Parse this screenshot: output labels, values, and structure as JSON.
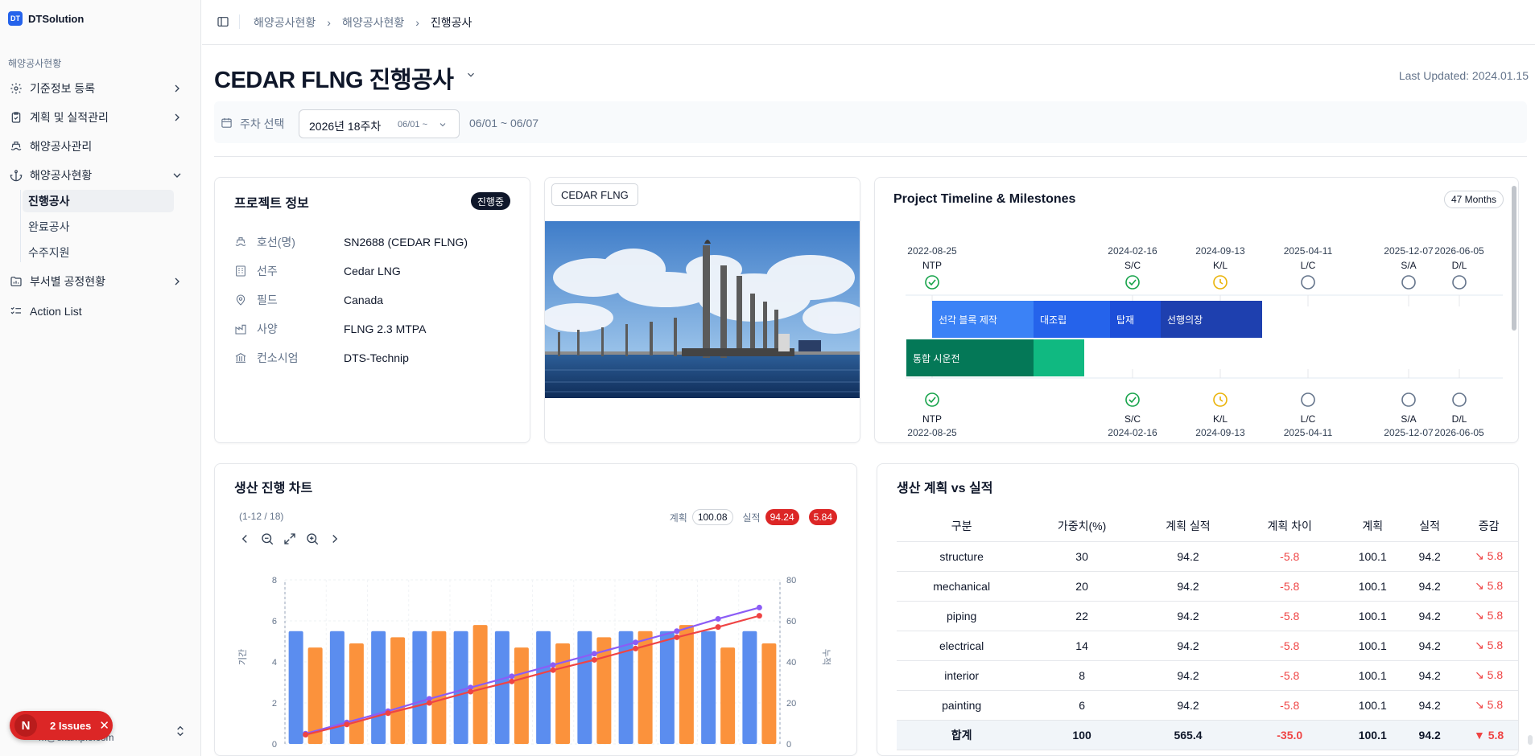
{
  "sidebar": {
    "brand": {
      "logo": "DT",
      "name": "DTSolution"
    },
    "group_label": "해양공사현황",
    "items": [
      {
        "label": "기준정보 등록",
        "icon": "gear-icon"
      },
      {
        "label": "계획 및 실적관리",
        "icon": "clipboard-icon"
      },
      {
        "label": "해양공사관리",
        "icon": "ship-icon"
      },
      {
        "label": "해양공사현황",
        "icon": "anchor-icon"
      },
      {
        "label": "부서별 공정현황",
        "icon": "folder-chart-icon"
      },
      {
        "label": "Action List",
        "icon": "list-check-icon"
      }
    ],
    "subitems": [
      "진행공사",
      "완료공사",
      "수주지원"
    ],
    "footer_email": "m@example.com"
  },
  "issues_badge": {
    "initial": "N",
    "label": "2 Issues"
  },
  "breadcrumb": [
    "해양공사현황",
    "해양공사현황",
    "진행공사"
  ],
  "page": {
    "title": "CEDAR FLNG 진행공사",
    "last_updated": "Last Updated: 2024.01.15"
  },
  "week_filter": {
    "label": "주차 선택",
    "selected": "2026년 18주차",
    "selected_sub": "06/01 ~",
    "range": "06/01 ~ 06/07"
  },
  "project_info": {
    "title": "프로젝트 정보",
    "status": "진행중",
    "rows": [
      {
        "label": "호선(명)",
        "value": "SN2688 (CEDAR FLNG)",
        "icon": "ship-icon"
      },
      {
        "label": "선주",
        "value": "Cedar LNG",
        "icon": "building-icon"
      },
      {
        "label": "필드",
        "value": "Canada",
        "icon": "map-pin-icon"
      },
      {
        "label": "사양",
        "value": "FLNG 2.3 MTPA",
        "icon": "factory-icon"
      },
      {
        "label": "컨소시엄",
        "value": "DTS-Technip",
        "icon": "bank-icon"
      }
    ]
  },
  "image_card": {
    "tag": "CEDAR FLNG"
  },
  "timeline": {
    "title": "Project Timeline & Milestones",
    "duration": "47 Months",
    "milestones": [
      {
        "code": "NTP",
        "date": "2022-08-25",
        "state": "done",
        "color": "#16a34a"
      },
      {
        "code": "S/C",
        "date": "2024-02-16",
        "state": "done",
        "color": "#16a34a"
      },
      {
        "code": "K/L",
        "date": "2024-09-13",
        "state": "in-progress",
        "color": "#eab308"
      },
      {
        "code": "L/C",
        "date": "2025-04-11",
        "state": "pending",
        "color": "#64748b"
      },
      {
        "code": "S/A",
        "date": "2025-12-07",
        "state": "pending",
        "color": "#64748b"
      },
      {
        "code": "D/L",
        "date": "2026-06-05",
        "state": "pending",
        "color": "#64748b"
      }
    ],
    "phases_row1": [
      {
        "label": "선각 블록 제작",
        "color": "#3b82f6"
      },
      {
        "label": "대조립",
        "color": "#2563eb"
      },
      {
        "label": "탑재",
        "color": "#1d4ed8"
      },
      {
        "label": "선행의장",
        "color": "#1e40af"
      }
    ],
    "phases_row2": [
      {
        "label": "통합 시운전",
        "color": "#047857"
      },
      {
        "label": "",
        "color": "#10b981"
      }
    ]
  },
  "production_chart": {
    "title": "생산 진행 차트",
    "range_label": "(1-12 / 18)",
    "legend_plan": "계획",
    "plan_value": "100.08",
    "legend_actual": "실적",
    "actual_value": "94.24",
    "diff_value": "5.84"
  },
  "chart_data": {
    "type": "bar",
    "ylabel": "기간",
    "y2label": "누적",
    "ylim": [
      0,
      8
    ],
    "y2lim": [
      0,
      80
    ],
    "yticks": [
      "0",
      "2",
      "4",
      "6",
      "8"
    ],
    "y2ticks": [
      "0",
      "20",
      "40",
      "60",
      "80"
    ],
    "series": [
      {
        "values": [
          5.5,
          5.5,
          5.5,
          5.5,
          5.5,
          5.5,
          5.5,
          5.5,
          5.5,
          5.5,
          5.5,
          5.5
        ],
        "color": "#5b8def"
      },
      {
        "values": [
          4.7,
          4.9,
          5.2,
          5.5,
          5.8,
          4.7,
          4.9,
          5.2,
          5.5,
          5.8,
          4.7,
          4.9
        ],
        "color": "#fb923c"
      },
      {
        "type": "line",
        "axis": "y2",
        "values": [
          5,
          10.5,
          16,
          22,
          27.5,
          33,
          38.5,
          44,
          49.5,
          55,
          61,
          66.5
        ],
        "color": "#8b5cf6"
      },
      {
        "type": "line",
        "axis": "y2",
        "values": [
          4.5,
          9.5,
          15,
          20,
          25.5,
          30.5,
          36,
          41,
          46.5,
          52,
          57,
          62.5
        ],
        "color": "#ef4444"
      }
    ]
  },
  "plan_vs_actual": {
    "title": "생산 계획 vs 실적",
    "headers": [
      "구분",
      "가중치(%)",
      "계획 실적",
      "계획 차이",
      "계획",
      "실적",
      "증감"
    ],
    "rows": [
      [
        "structure",
        "30",
        "94.2",
        "-5.8",
        "100.1",
        "94.2",
        "↘ 5.8"
      ],
      [
        "mechanical",
        "20",
        "94.2",
        "-5.8",
        "100.1",
        "94.2",
        "↘ 5.8"
      ],
      [
        "piping",
        "22",
        "94.2",
        "-5.8",
        "100.1",
        "94.2",
        "↘ 5.8"
      ],
      [
        "electrical",
        "14",
        "94.2",
        "-5.8",
        "100.1",
        "94.2",
        "↘ 5.8"
      ],
      [
        "interior",
        "8",
        "94.2",
        "-5.8",
        "100.1",
        "94.2",
        "↘ 5.8"
      ],
      [
        "painting",
        "6",
        "94.2",
        "-5.8",
        "100.1",
        "94.2",
        "↘ 5.8"
      ]
    ],
    "total": [
      "합계",
      "100",
      "565.4",
      "-35.0",
      "100.1",
      "94.2",
      "▼ 5.8"
    ]
  }
}
